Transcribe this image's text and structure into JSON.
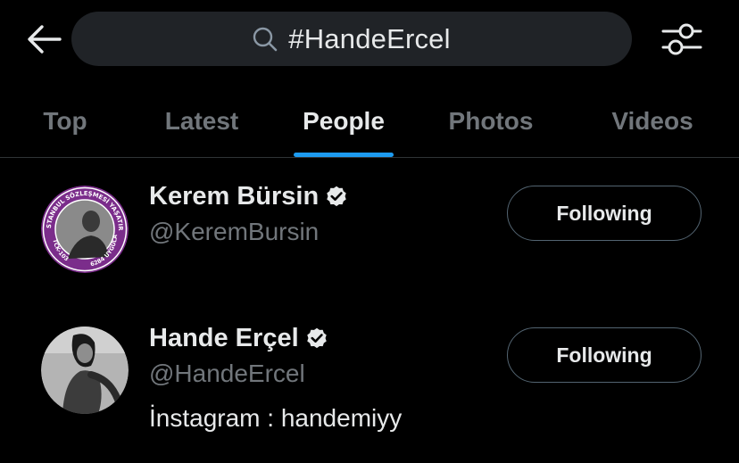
{
  "search": {
    "query": "#HandeErcel"
  },
  "tabs": [
    {
      "label": "Top",
      "active": false
    },
    {
      "label": "Latest",
      "active": false
    },
    {
      "label": "People",
      "active": true
    },
    {
      "label": "Photos",
      "active": false
    },
    {
      "label": "Videos",
      "active": false
    }
  ],
  "users": [
    {
      "name": "Kerem Bürsin",
      "handle": "@KeremBursin",
      "verified": true,
      "follow_label": "Following",
      "avatar_badge": {
        "top_text": "İSTANBUL SÖZLEŞMESİ YAŞATIR",
        "left_text": "TCK-103",
        "right_text": "6284 UYGULA",
        "ring_color": "#7b2d8b"
      }
    },
    {
      "name": "Hande Erçel",
      "handle": "@HandeErcel",
      "verified": true,
      "follow_label": "Following",
      "bio": "İnstagram : handemiyy"
    }
  ],
  "colors": {
    "accent": "#1d9bf0",
    "background": "#000000",
    "muted": "#71767b",
    "text": "#e7e9ea",
    "search_bg": "#202327"
  },
  "icons": {
    "back": "arrow-left-icon",
    "search": "search-icon",
    "filter": "sliders-icon",
    "verified": "verified-badge-icon"
  }
}
